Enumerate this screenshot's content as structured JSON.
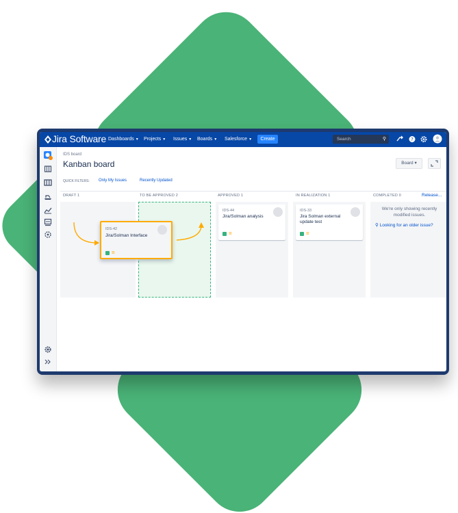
{
  "colors": {
    "decor_green": "#4ab377",
    "device_frame": "#1e3a6e",
    "topbar": "#0747a6",
    "accent": "#0052cc",
    "create": "#2684ff",
    "highlight": "#ffab00"
  },
  "app": {
    "name": "Jira Software"
  },
  "nav": {
    "items": [
      "Dashboards",
      "Projects",
      "Issues",
      "Boards",
      "Salesforce"
    ],
    "create_label": "Create"
  },
  "search": {
    "placeholder": "Search"
  },
  "icons": {
    "topbar": [
      "jira-logo-icon",
      "search-icon",
      "feedback-icon",
      "help-icon",
      "settings-icon",
      "user-avatar-icon"
    ],
    "sidebar": [
      "project-avatar-icon",
      "backlog-icon",
      "board-icon",
      "releases-icon",
      "reports-icon",
      "components-icon",
      "add-item-icon",
      "project-settings-icon",
      "expand-sidebar-icon"
    ]
  },
  "board": {
    "breadcrumb": "IDS board",
    "title": "Kanban board",
    "quick_filters_label": "QUICK FILTERS:",
    "filters": [
      "Only My Issues",
      "Recently Updated"
    ],
    "board_button": "Board",
    "columns": [
      {
        "name": "DRAFT",
        "count": "1"
      },
      {
        "name": "TO BE APPROVED",
        "count": "2"
      },
      {
        "name": "APPROVED",
        "count": "1"
      },
      {
        "name": "IN REALIZATION",
        "count": "1"
      },
      {
        "name": "COMPLETED",
        "count": "0"
      }
    ],
    "release_link": "Release...",
    "cards": [
      {
        "key": "IDS-42",
        "summary": "Jira/Solman Interface"
      },
      {
        "key": "IDS-44",
        "summary": "Jira/Solman analysis"
      },
      {
        "key": "IDS-33",
        "summary_line1": "Jira Solman external",
        "summary_line2": "update test"
      }
    ],
    "completed_note_line1": "We're only showing recently",
    "completed_note_line2": "modified issues.",
    "older_link": "Looking for an older issue?"
  }
}
